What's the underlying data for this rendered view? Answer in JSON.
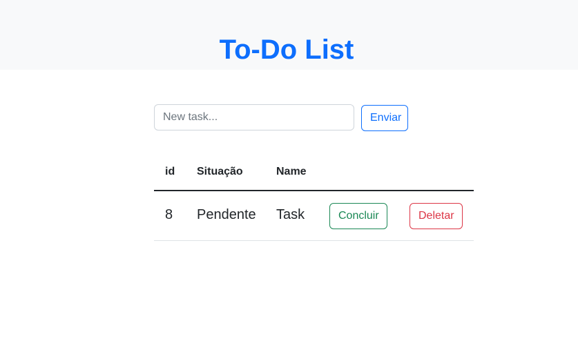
{
  "header": {
    "title": "To-Do List"
  },
  "form": {
    "input_placeholder": "New task...",
    "input_value": "",
    "submit_label": "Enviar"
  },
  "table": {
    "columns": [
      "id",
      "Situação",
      "Name"
    ],
    "rows": [
      {
        "id": "8",
        "status": "Pendente",
        "name": "Task",
        "complete_label": "Concluir",
        "delete_label": "Deletar"
      }
    ]
  },
  "colors": {
    "primary": "#0d6efd",
    "success": "#198754",
    "danger": "#dc3545",
    "header_bg": "#f8f9fa"
  }
}
